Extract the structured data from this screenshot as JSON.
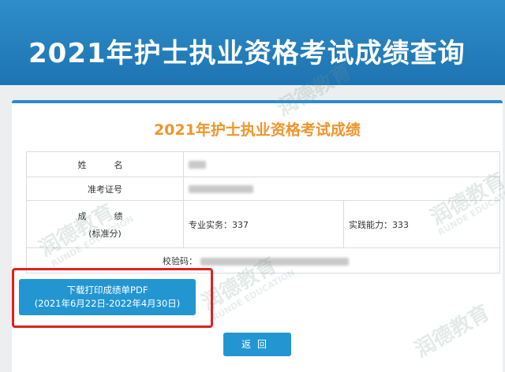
{
  "banner": {
    "title": "2021年护士执业资格考试成绩查询"
  },
  "result": {
    "title": "2021年护士执业资格考试成绩",
    "name_label": "姓　名",
    "exam_id_label": "准考证号",
    "score_label_1": "成　绩",
    "score_label_2": "(标准分)",
    "professional_practice": "专业实务：337",
    "practical_ability": "实践能力：333",
    "check_code_label": "校验码："
  },
  "actions": {
    "download_line1": "下载打印成绩单PDF",
    "download_line2": "(2021年6月22日-2022年4月30日)",
    "back": "返回"
  },
  "watermark": {
    "brand": "润德教育",
    "brand_en": "RUNDE EDUCATION"
  },
  "colors": {
    "banner": "#1d74b2",
    "title_orange": "#f0952a",
    "button": "#2396d2",
    "highlight_red": "#e0221b"
  }
}
